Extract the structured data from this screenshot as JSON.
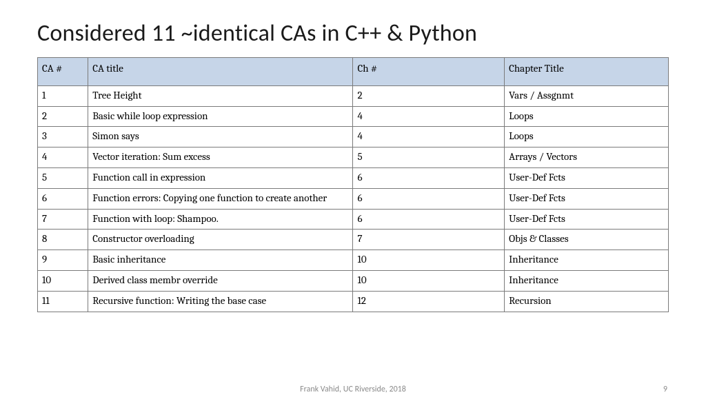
{
  "title": "Considered 11 ~identical CAs in C++ & Python",
  "headers": {
    "ca_num": "CA #",
    "ca_title": "CA title",
    "ch_num": "Ch #",
    "chapter_title": "Chapter Title"
  },
  "rows": [
    {
      "ca_num": "1",
      "ca_title": "Tree Height",
      "ch_num": "2",
      "chapter": "Vars / Assgnmt"
    },
    {
      "ca_num": "2",
      "ca_title": "Basic while loop expression",
      "ch_num": "4",
      "chapter": "Loops"
    },
    {
      "ca_num": "3",
      "ca_title": "Simon says",
      "ch_num": "4",
      "chapter": "Loops"
    },
    {
      "ca_num": "4",
      "ca_title": "Vector iteration: Sum excess",
      "ch_num": "5",
      "chapter": "Arrays / Vectors"
    },
    {
      "ca_num": "5",
      "ca_title": "Function call in expression",
      "ch_num": "6",
      "chapter": "User-Def Fcts"
    },
    {
      "ca_num": "6",
      "ca_title": "Function errors: Copying one function to create another",
      "ch_num": "6",
      "chapter": "User-Def Fcts"
    },
    {
      "ca_num": "7",
      "ca_title": "Function with loop: Shampoo.",
      "ch_num": "6",
      "chapter": "User-Def Fcts"
    },
    {
      "ca_num": "8",
      "ca_title": "Constructor overloading",
      "ch_num": "7",
      "chapter": "Objs & Classes"
    },
    {
      "ca_num": "9",
      "ca_title": "Basic inheritance",
      "ch_num": "10",
      "chapter": "Inheritance"
    },
    {
      "ca_num": "10",
      "ca_title": "Derived class membr override",
      "ch_num": "10",
      "chapter": "Inheritance"
    },
    {
      "ca_num": "11",
      "ca_title": "Recursive function: Writing the base case",
      "ch_num": "12",
      "chapter": "Recursion"
    }
  ],
  "footer": {
    "center": "Frank Vahid, UC Riverside, 2018",
    "page": "9"
  }
}
